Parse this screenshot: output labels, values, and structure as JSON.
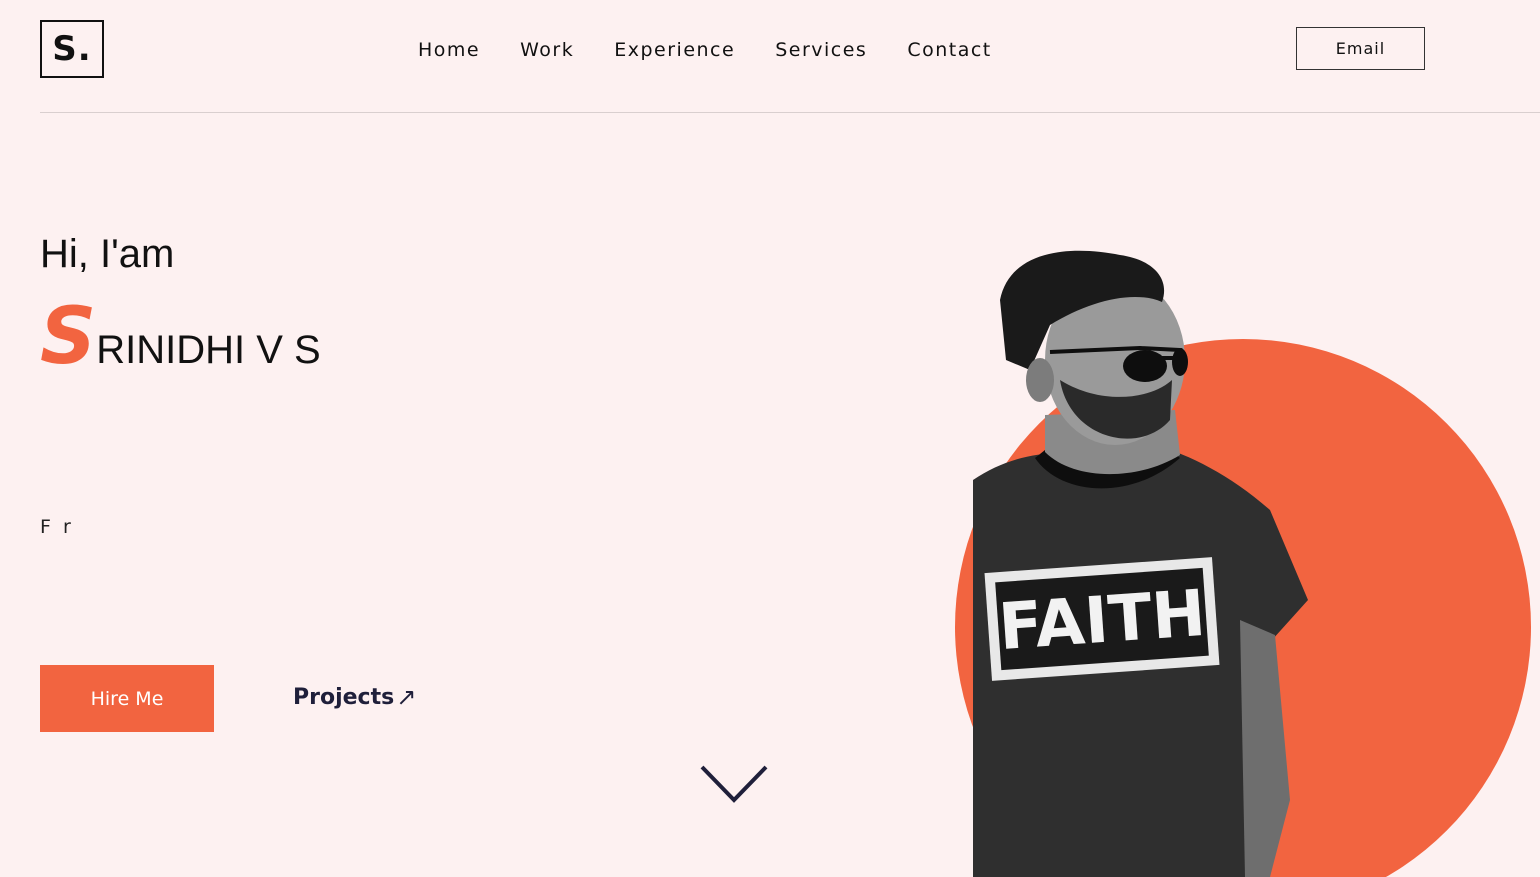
{
  "header": {
    "logo": "S.",
    "nav": [
      "Home",
      "Work",
      "Experience",
      "Services",
      "Contact"
    ],
    "email_label": "Email"
  },
  "hero": {
    "greeting": "Hi, I'am",
    "name_first_letter": "S",
    "name_rest": "RINIDHI V S",
    "tagline": "F r",
    "hire_label": "Hire Me",
    "projects_label": "Projects",
    "projects_arrow": "↗",
    "shirt_text": "FAITH"
  },
  "colors": {
    "background": "#fdf1f1",
    "accent": "#f26440",
    "text": "#111111",
    "link": "#1f1f3a"
  }
}
